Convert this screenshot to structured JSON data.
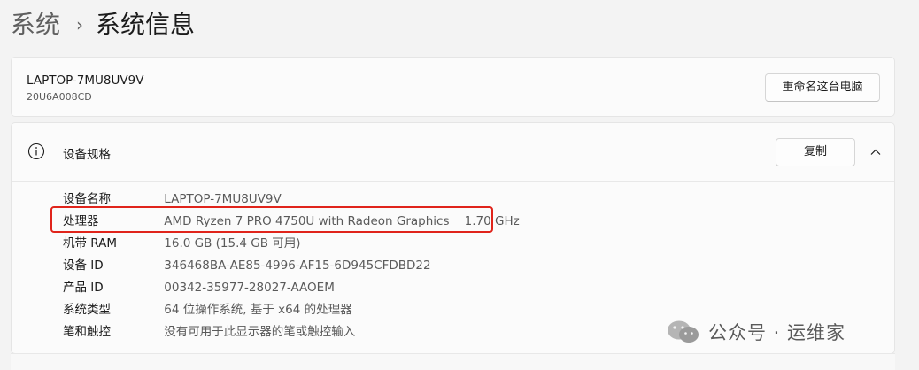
{
  "breadcrumb": {
    "parent": "系统",
    "separator": "›",
    "current": "系统信息"
  },
  "device": {
    "name": "LAPTOP-7MU8UV9V",
    "model": "20U6A008CD",
    "rename_button": "重命名这台电脑"
  },
  "specs": {
    "title": "设备规格",
    "copy_button": "复制",
    "rows": [
      {
        "label": "设备名称",
        "value": "LAPTOP-7MU8UV9V"
      },
      {
        "label": "处理器",
        "value": "AMD Ryzen 7 PRO 4750U with Radeon Graphics    1.70 GHz"
      },
      {
        "label": "机带 RAM",
        "value": "16.0 GB (15.4 GB 可用)"
      },
      {
        "label": "设备 ID",
        "value": "346468BA-AE85-4996-AF15-6D945CFDBD22"
      },
      {
        "label": "产品 ID",
        "value": "00342-35977-28027-AAOEM"
      },
      {
        "label": "系统类型",
        "value": "64 位操作系统, 基于 x64 的处理器"
      },
      {
        "label": "笔和触控",
        "value": "没有可用于此显示器的笔或触控输入"
      }
    ]
  },
  "watermark": {
    "text": "公众号 · 运维家"
  },
  "colors": {
    "highlight": "#e0241b",
    "background": "#f3f3f3",
    "card": "#fbfbfb"
  }
}
